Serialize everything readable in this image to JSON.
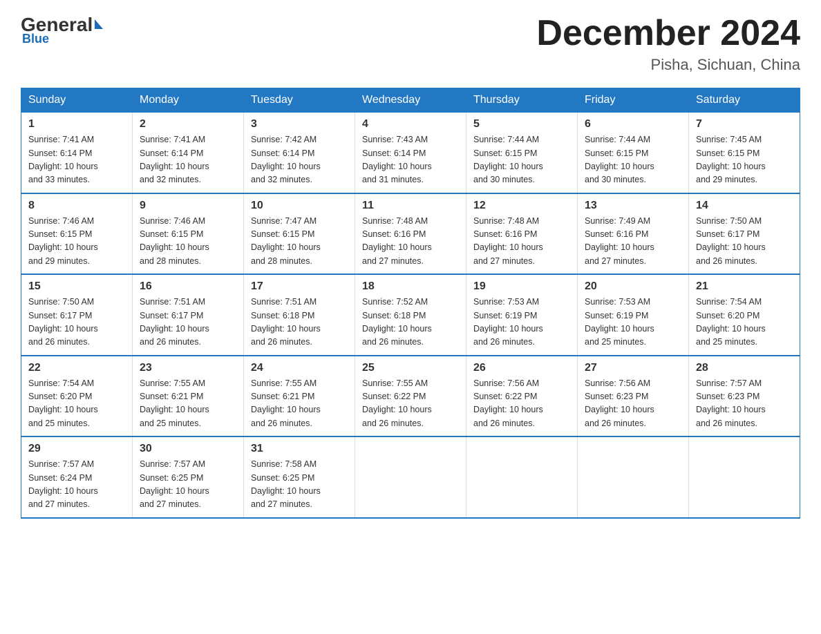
{
  "logo": {
    "general": "General",
    "blue": "Blue"
  },
  "title": "December 2024",
  "subtitle": "Pisha, Sichuan, China",
  "days_of_week": [
    "Sunday",
    "Monday",
    "Tuesday",
    "Wednesday",
    "Thursday",
    "Friday",
    "Saturday"
  ],
  "weeks": [
    [
      {
        "day": "1",
        "sunrise": "7:41 AM",
        "sunset": "6:14 PM",
        "daylight": "10 hours and 33 minutes."
      },
      {
        "day": "2",
        "sunrise": "7:41 AM",
        "sunset": "6:14 PM",
        "daylight": "10 hours and 32 minutes."
      },
      {
        "day": "3",
        "sunrise": "7:42 AM",
        "sunset": "6:14 PM",
        "daylight": "10 hours and 32 minutes."
      },
      {
        "day": "4",
        "sunrise": "7:43 AM",
        "sunset": "6:14 PM",
        "daylight": "10 hours and 31 minutes."
      },
      {
        "day": "5",
        "sunrise": "7:44 AM",
        "sunset": "6:15 PM",
        "daylight": "10 hours and 30 minutes."
      },
      {
        "day": "6",
        "sunrise": "7:44 AM",
        "sunset": "6:15 PM",
        "daylight": "10 hours and 30 minutes."
      },
      {
        "day": "7",
        "sunrise": "7:45 AM",
        "sunset": "6:15 PM",
        "daylight": "10 hours and 29 minutes."
      }
    ],
    [
      {
        "day": "8",
        "sunrise": "7:46 AM",
        "sunset": "6:15 PM",
        "daylight": "10 hours and 29 minutes."
      },
      {
        "day": "9",
        "sunrise": "7:46 AM",
        "sunset": "6:15 PM",
        "daylight": "10 hours and 28 minutes."
      },
      {
        "day": "10",
        "sunrise": "7:47 AM",
        "sunset": "6:15 PM",
        "daylight": "10 hours and 28 minutes."
      },
      {
        "day": "11",
        "sunrise": "7:48 AM",
        "sunset": "6:16 PM",
        "daylight": "10 hours and 27 minutes."
      },
      {
        "day": "12",
        "sunrise": "7:48 AM",
        "sunset": "6:16 PM",
        "daylight": "10 hours and 27 minutes."
      },
      {
        "day": "13",
        "sunrise": "7:49 AM",
        "sunset": "6:16 PM",
        "daylight": "10 hours and 27 minutes."
      },
      {
        "day": "14",
        "sunrise": "7:50 AM",
        "sunset": "6:17 PM",
        "daylight": "10 hours and 26 minutes."
      }
    ],
    [
      {
        "day": "15",
        "sunrise": "7:50 AM",
        "sunset": "6:17 PM",
        "daylight": "10 hours and 26 minutes."
      },
      {
        "day": "16",
        "sunrise": "7:51 AM",
        "sunset": "6:17 PM",
        "daylight": "10 hours and 26 minutes."
      },
      {
        "day": "17",
        "sunrise": "7:51 AM",
        "sunset": "6:18 PM",
        "daylight": "10 hours and 26 minutes."
      },
      {
        "day": "18",
        "sunrise": "7:52 AM",
        "sunset": "6:18 PM",
        "daylight": "10 hours and 26 minutes."
      },
      {
        "day": "19",
        "sunrise": "7:53 AM",
        "sunset": "6:19 PM",
        "daylight": "10 hours and 26 minutes."
      },
      {
        "day": "20",
        "sunrise": "7:53 AM",
        "sunset": "6:19 PM",
        "daylight": "10 hours and 25 minutes."
      },
      {
        "day": "21",
        "sunrise": "7:54 AM",
        "sunset": "6:20 PM",
        "daylight": "10 hours and 25 minutes."
      }
    ],
    [
      {
        "day": "22",
        "sunrise": "7:54 AM",
        "sunset": "6:20 PM",
        "daylight": "10 hours and 25 minutes."
      },
      {
        "day": "23",
        "sunrise": "7:55 AM",
        "sunset": "6:21 PM",
        "daylight": "10 hours and 25 minutes."
      },
      {
        "day": "24",
        "sunrise": "7:55 AM",
        "sunset": "6:21 PM",
        "daylight": "10 hours and 26 minutes."
      },
      {
        "day": "25",
        "sunrise": "7:55 AM",
        "sunset": "6:22 PM",
        "daylight": "10 hours and 26 minutes."
      },
      {
        "day": "26",
        "sunrise": "7:56 AM",
        "sunset": "6:22 PM",
        "daylight": "10 hours and 26 minutes."
      },
      {
        "day": "27",
        "sunrise": "7:56 AM",
        "sunset": "6:23 PM",
        "daylight": "10 hours and 26 minutes."
      },
      {
        "day": "28",
        "sunrise": "7:57 AM",
        "sunset": "6:23 PM",
        "daylight": "10 hours and 26 minutes."
      }
    ],
    [
      {
        "day": "29",
        "sunrise": "7:57 AM",
        "sunset": "6:24 PM",
        "daylight": "10 hours and 27 minutes."
      },
      {
        "day": "30",
        "sunrise": "7:57 AM",
        "sunset": "6:25 PM",
        "daylight": "10 hours and 27 minutes."
      },
      {
        "day": "31",
        "sunrise": "7:58 AM",
        "sunset": "6:25 PM",
        "daylight": "10 hours and 27 minutes."
      },
      null,
      null,
      null,
      null
    ]
  ],
  "labels": {
    "sunrise": "Sunrise:",
    "sunset": "Sunset:",
    "daylight": "Daylight:"
  }
}
